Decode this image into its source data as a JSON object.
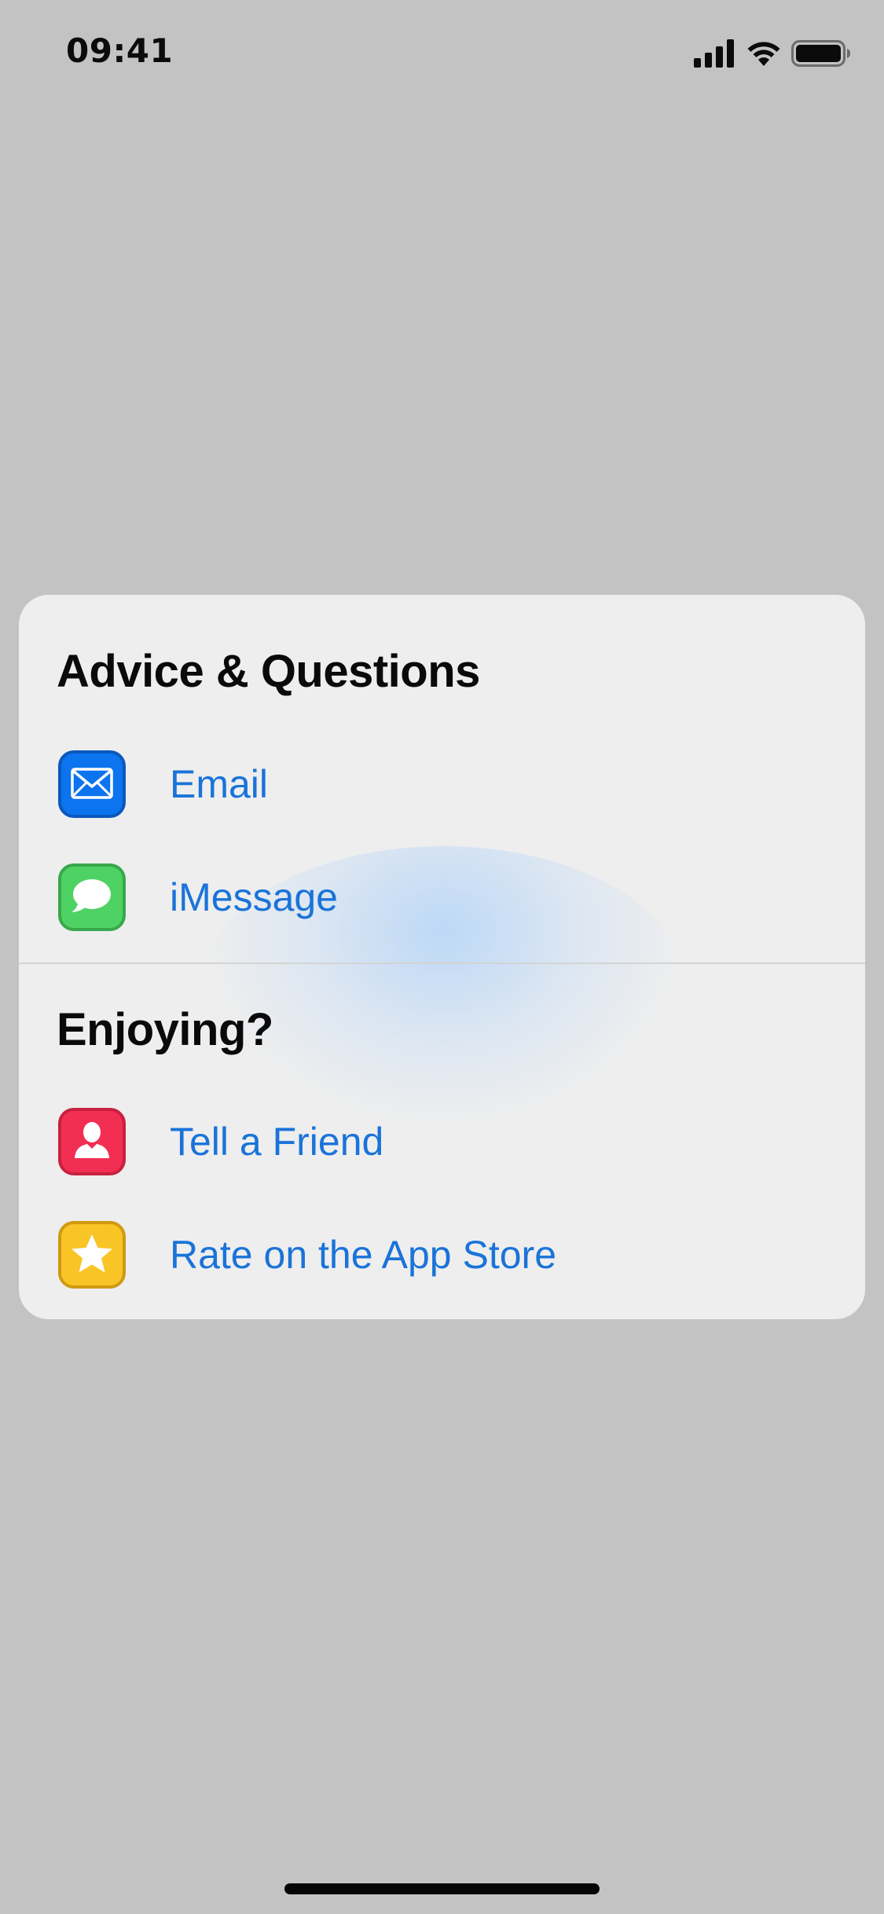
{
  "status_bar": {
    "time": "09:41",
    "icons": [
      "cellular-signal-icon",
      "wifi-icon",
      "battery-icon"
    ]
  },
  "sheet": {
    "sections": [
      {
        "title": "Advice & Questions",
        "rows": [
          {
            "label": "Email",
            "icon": "mail-icon",
            "color": "#0b74ee"
          },
          {
            "label": "iMessage",
            "icon": "message-bubble-icon",
            "color": "#4fd264"
          }
        ]
      },
      {
        "title": "Enjoying?",
        "rows": [
          {
            "label": "Tell a Friend",
            "icon": "person-icon",
            "color": "#f22f53"
          },
          {
            "label": "Rate on the App Store",
            "icon": "star-icon",
            "color": "#f9c426"
          }
        ]
      }
    ]
  },
  "colors": {
    "background": "#c3c3c3",
    "sheet": "#eeeeee",
    "link": "#1a73d9",
    "text": "#0a0a0a"
  }
}
